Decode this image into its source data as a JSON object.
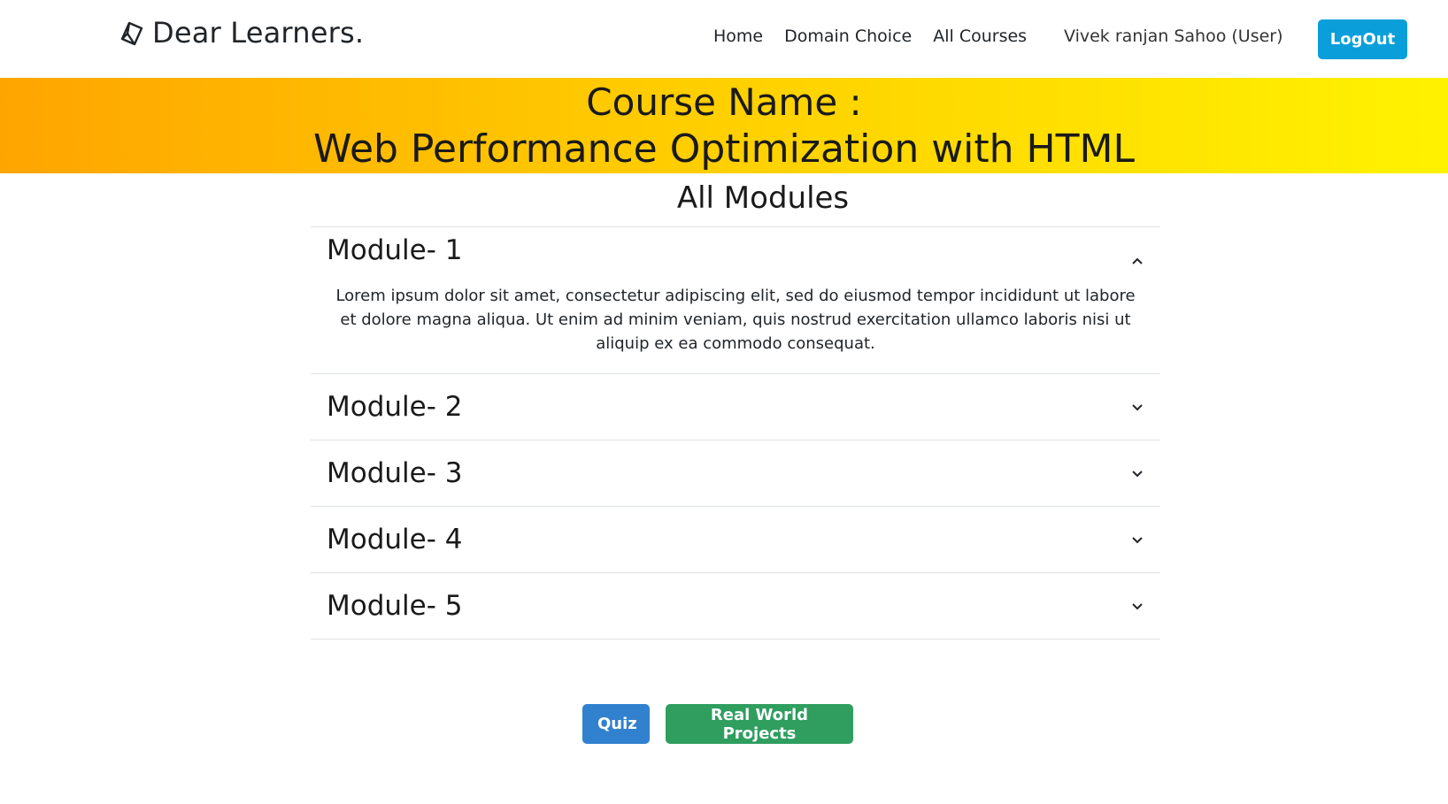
{
  "brand": {
    "name": "Dear Learners.",
    "icon": "book-icon"
  },
  "nav": {
    "links": [
      "Home",
      "Domain Choice",
      "All Courses"
    ],
    "user": "Vivek ranjan Sahoo (User)",
    "logout": "LogOut",
    "logout_color": "#0a9fdb"
  },
  "hero": {
    "line1": "Course Name :",
    "line2": "Web Performance Optimization with HTML"
  },
  "modules": {
    "title": "All Modules",
    "items": [
      {
        "title": "Module- 1",
        "expanded": true,
        "body": "Lorem ipsum dolor sit amet, consectetur adipiscing elit, sed do eiusmod tempor incididunt ut labore et dolore magna aliqua. Ut enim ad minim veniam, quis nostrud exercitation ullamco laboris nisi ut aliquip ex ea commodo consequat."
      },
      {
        "title": "Module- 2",
        "expanded": false
      },
      {
        "title": "Module- 3",
        "expanded": false
      },
      {
        "title": "Module- 4",
        "expanded": false
      },
      {
        "title": "Module- 5",
        "expanded": false
      }
    ]
  },
  "actions": {
    "quiz": "Quiz",
    "projects": "Real World Projects",
    "quiz_color": "#3181ce",
    "projects_color": "#2f9e5f"
  }
}
